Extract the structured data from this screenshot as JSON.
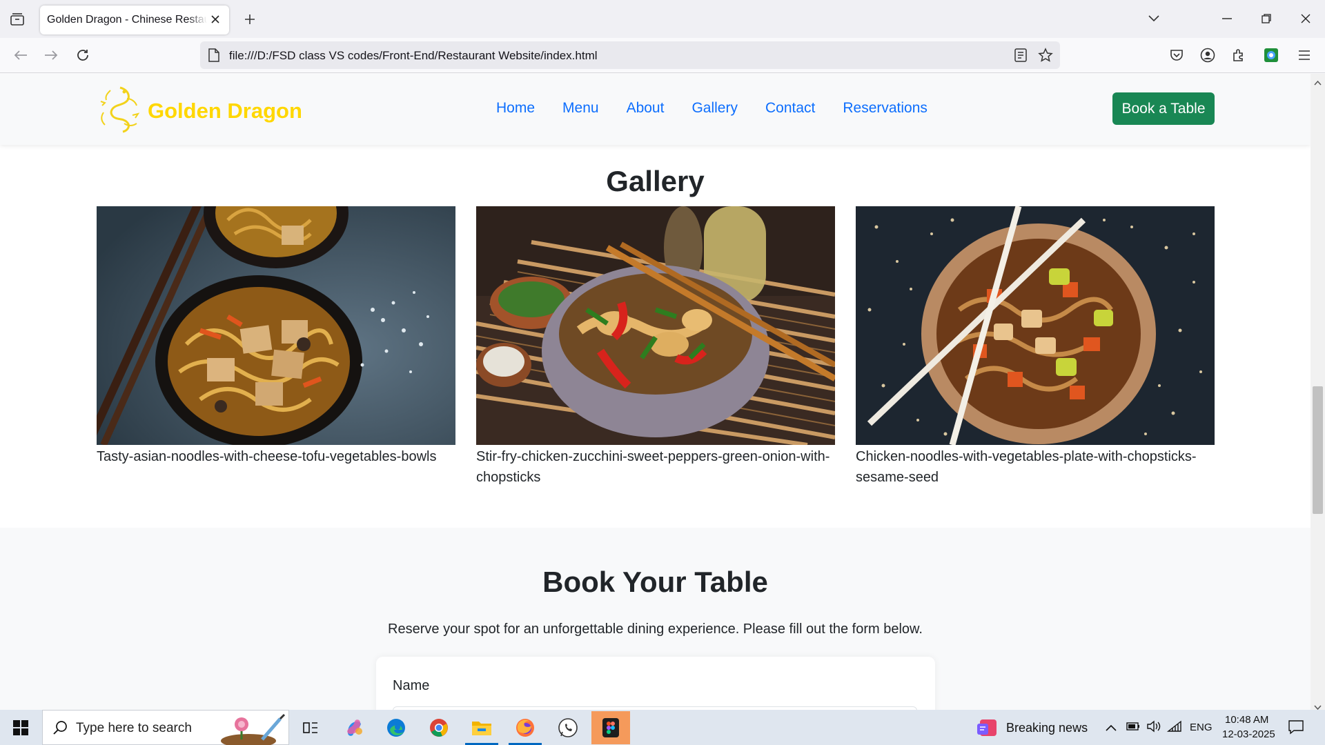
{
  "browser": {
    "tab_title": "Golden Dragon - Chinese Restaurant",
    "url": "file:///D:/FSD class VS codes/Front-End/Restaurant Website/index.html"
  },
  "site": {
    "logo_text": "Golden Dragon",
    "nav": [
      "Home",
      "Menu",
      "About",
      "Gallery",
      "Contact",
      "Reservations"
    ],
    "cta_label": "Book a Table"
  },
  "gallery": {
    "title": "Gallery",
    "items": [
      {
        "caption": "Tasty-asian-noodles-with-cheese-tofu-vegetables-bowls"
      },
      {
        "caption": "Stir-fry-chicken-zucchini-sweet-peppers-green-onion-with-chopsticks"
      },
      {
        "caption": "Chicken-noodles-with-vegetables-plate-with-chopsticks-sesame-seed"
      }
    ]
  },
  "booking": {
    "title": "Book Your Table",
    "description": "Reserve your spot for an unforgettable dining experience. Please fill out the form below.",
    "name_label": "Name"
  },
  "taskbar": {
    "search_placeholder": "Type here to search",
    "news": "Breaking news",
    "language": "ENG",
    "time": "10:48 AM",
    "date": "12-03-2025"
  },
  "colors": {
    "logo": "#ffd700",
    "nav_link": "#0d6efd",
    "cta": "#198754"
  }
}
